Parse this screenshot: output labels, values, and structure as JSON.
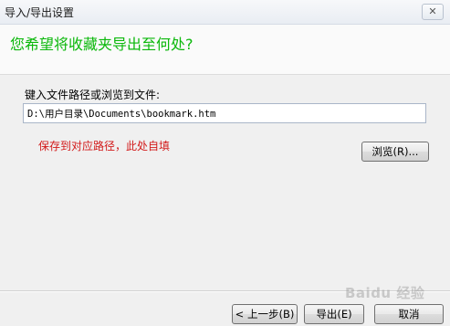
{
  "window": {
    "title": "导入/导出设置",
    "close_glyph": "✕"
  },
  "header": {
    "heading": "您希望将收藏夹导出至何处?"
  },
  "form": {
    "path_label": "键入文件路径或浏览到文件:",
    "path_value": "D:\\用户目录\\Documents\\bookmark.htm",
    "browse_label": "浏览(R)..."
  },
  "annotation": {
    "text": "保存到对应路径，此处自填",
    "color": "#d21a1a"
  },
  "footer": {
    "prev_label": "< 上一步(B)",
    "export_label": "导出(E)",
    "cancel_label": "取消"
  },
  "watermark": {
    "text": "Baidu 经验"
  },
  "colors": {
    "heading": "#0bb80b",
    "background": "#f0f0f0"
  }
}
